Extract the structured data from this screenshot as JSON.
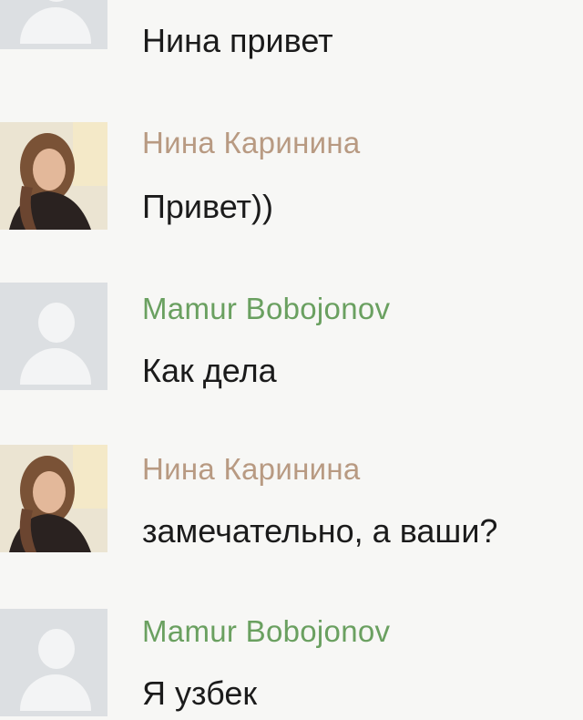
{
  "colors": {
    "background": "#f7f7f5",
    "author_female": "#b89a82",
    "author_male": "#6aa060",
    "message_text": "#1b1b1b",
    "avatar_placeholder_bg": "#dcdfe2"
  },
  "messages": [
    {
      "author": "",
      "text": "Нина привет",
      "avatar": "user-placeholder-icon"
    },
    {
      "author": "Нина Каринина",
      "text": "Привет))",
      "avatar": "profile-photo"
    },
    {
      "author": "Mamur Bobojonov",
      "text": "Как дела",
      "avatar": "user-placeholder-icon"
    },
    {
      "author": "Нина Каринина",
      "text": "замечательно, а ваши?",
      "avatar": "profile-photo"
    },
    {
      "author": "Mamur Bobojonov",
      "text": "Я узбек",
      "avatar": "user-placeholder-icon"
    }
  ]
}
